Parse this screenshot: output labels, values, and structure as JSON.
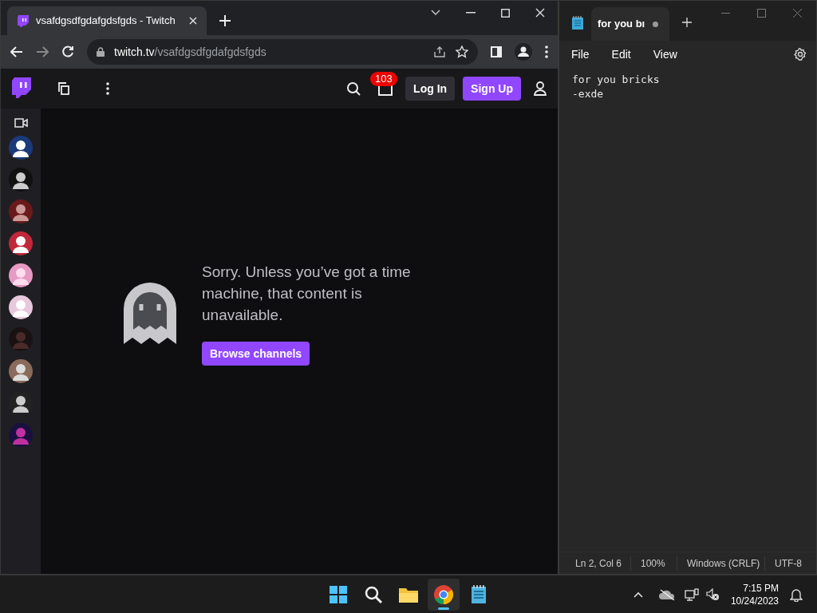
{
  "browser": {
    "tab": {
      "title": "vsafdgsdfgdafgdsfgds - Twitch",
      "selected": true
    },
    "url": {
      "host": "twitch.tv",
      "path": "/vsafdgsdfgdafgdsfgds"
    }
  },
  "twitch": {
    "notification_count": "103",
    "login": "Log In",
    "signup": "Sign Up",
    "message": "Sorry. Unless you’ve got a time machine, that content is unavailable.",
    "button": "Browse channels"
  },
  "notepad": {
    "tab": {
      "title": "for you bı",
      "selected": true,
      "unsaved": true
    },
    "menu": [
      "File",
      "Edit",
      "View"
    ],
    "lines": [
      "for you bricks",
      "-exde"
    ],
    "status_bar": [
      "Ln 2, Col 6",
      "100%",
      "Windows (CRLF)",
      "UTF-8"
    ]
  },
  "taskbar": {
    "apps": [
      {
        "kind": "start",
        "selected": false
      },
      {
        "kind": "search",
        "selected": false
      },
      {
        "kind": "folder",
        "selected": false
      },
      {
        "kind": "chrome",
        "selected": true
      },
      {
        "kind": "notepad",
        "selected": false
      }
    ],
    "time": "7:15 PM",
    "date": "10/24/2023"
  }
}
